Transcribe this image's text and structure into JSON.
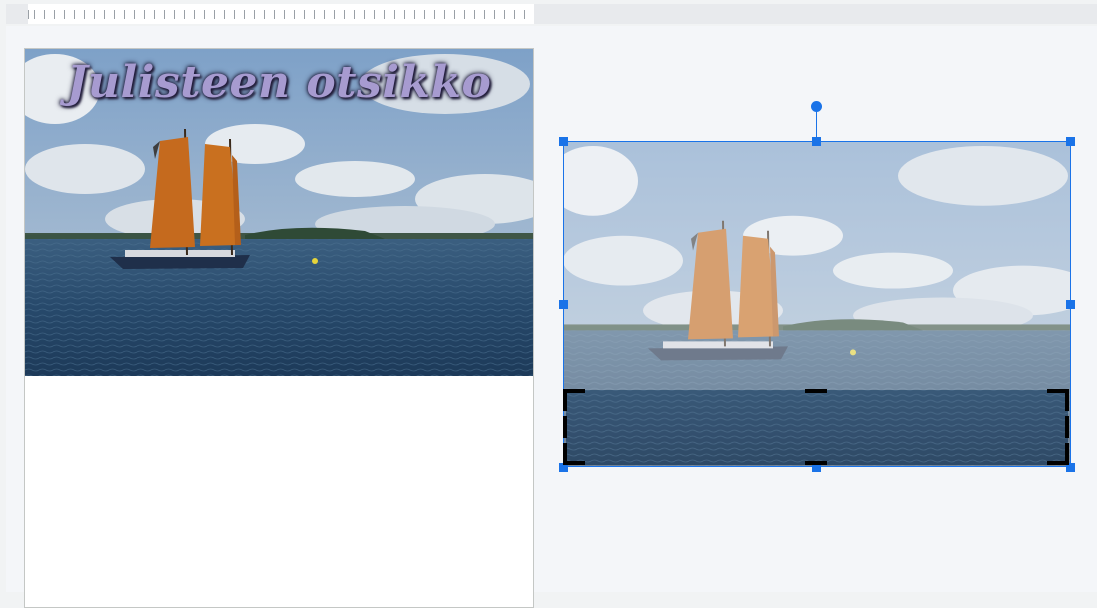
{
  "slide": {
    "title": "Julisteen otsikko"
  },
  "colors": {
    "selection": "#1a73e8",
    "crop_marks": "#000000",
    "title_text": "#a79bd0"
  },
  "images": {
    "banner": "sailboat-photo",
    "selected": "sailboat-photo-selected"
  },
  "state": {
    "mode": "crop",
    "selected_image": "sailboat-photo-selected"
  }
}
